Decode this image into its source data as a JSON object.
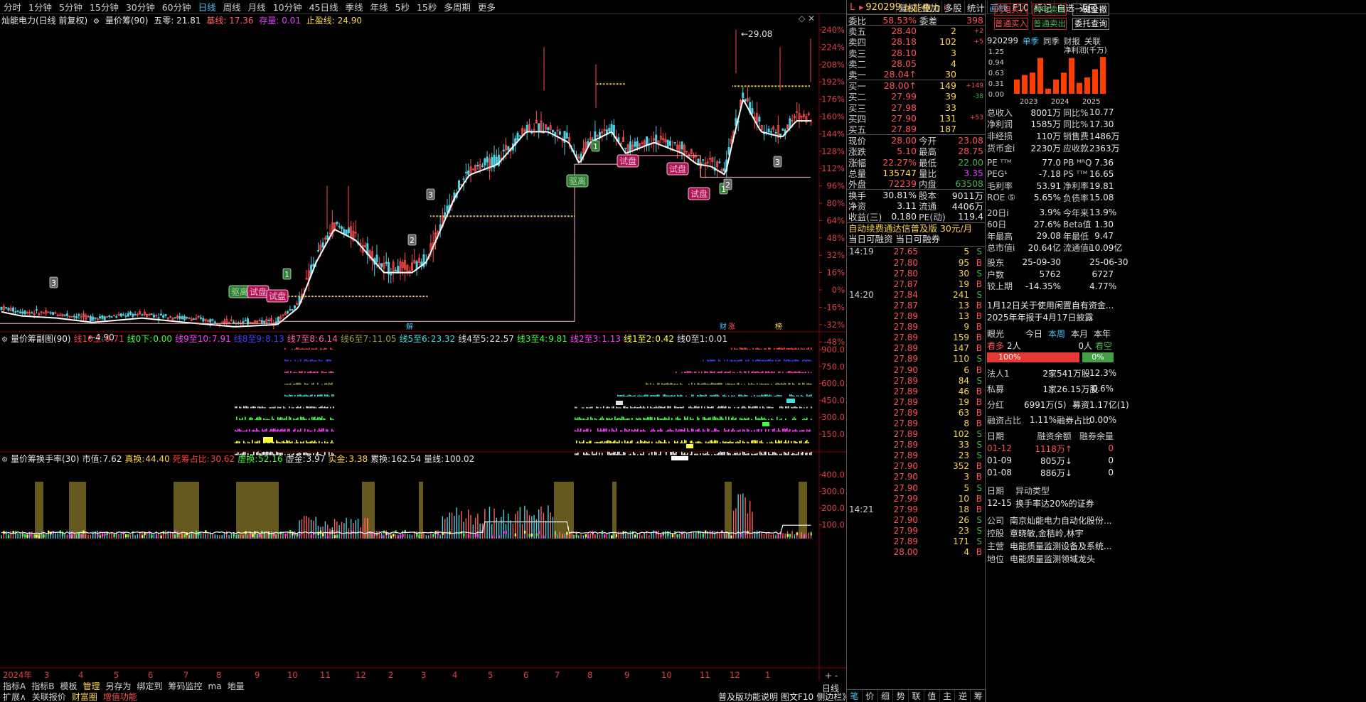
{
  "periods": [
    "分时",
    "1分钟",
    "5分钟",
    "15分钟",
    "30分钟",
    "60分钟",
    "日线",
    "周线",
    "月线",
    "10分钟",
    "45日线",
    "季线",
    "年线",
    "5秒",
    "15秒",
    "多周期",
    "更多"
  ],
  "active_period": "日线",
  "toolbar_right": [
    "复权",
    "叠加",
    "多股",
    "统计",
    "画线",
    "F10",
    "标记",
    "自选",
    "返回"
  ],
  "main_title": {
    "name": "灿能电力(日线 前复权)",
    "indicator": "量价筹(90)",
    "wuling": "五零: 21.81",
    "jixian": "基线: 17.36",
    "cunliang": "存量: 0.01",
    "zhiying": "止盈线: 24.90"
  },
  "main_axis": [
    "240%",
    "224%",
    "208%",
    "192%",
    "176%",
    "160%",
    "144%",
    "128%",
    "112%",
    "96%",
    "80%",
    "64%",
    "48%",
    "32%",
    "16%",
    "0%",
    "-16%",
    "-32%",
    "-48%"
  ],
  "annotations": {
    "high_label": "29.08",
    "low_label": "4.90",
    "tags": [
      "驱离",
      "试盘",
      "试盘",
      "驱离",
      "试盘",
      "试盘",
      "试盘"
    ],
    "nums": [
      "3",
      "1",
      "3",
      "2",
      "1",
      "3",
      "1",
      "2"
    ]
  },
  "event_icons": [
    "财",
    "涨",
    "榜",
    "解"
  ],
  "sub1_title": {
    "name": "量价筹副图(90)",
    "items": [
      {
        "label": "线10上:",
        "val": "9.71",
        "color": "#ff4040"
      },
      {
        "label": "线0下:",
        "val": "0.00",
        "color": "#40ff40"
      },
      {
        "label": "线9至10:",
        "val": "7.91",
        "color": "#ff40ff"
      },
      {
        "label": "线8至9:",
        "val": "8.13",
        "color": "#4040ff"
      },
      {
        "label": "线7至8:",
        "val": "6.14",
        "color": "#ff60a0"
      },
      {
        "label": "线6至7:",
        "val": "11.05",
        "color": "#a0a040"
      },
      {
        "label": "线5至6:",
        "val": "23.32",
        "color": "#40e0e0"
      },
      {
        "label": "线4至5:",
        "val": "22.57",
        "color": "#e0e0e0"
      },
      {
        "label": "线3至4:",
        "val": "9.81",
        "color": "#40ff40"
      },
      {
        "label": "线2至3:",
        "val": "1.13",
        "color": "#ff40ff"
      },
      {
        "label": "线1至2:",
        "val": "0.42",
        "color": "#ffff40"
      },
      {
        "label": "线0至1:",
        "val": "0.01",
        "color": "#e0e0e0"
      }
    ]
  },
  "sub1_axis": [
    "900.0",
    "750.0",
    "600.0",
    "450.0",
    "300.0",
    "150.0"
  ],
  "sub2_title": {
    "name": "量价筹换手率(30)",
    "items": [
      {
        "label": "市值:",
        "val": "7.62",
        "color": "#e0e0e0"
      },
      {
        "label": "真换:",
        "val": "44.40",
        "color": "#ffd54f"
      },
      {
        "label": "死筹占比:",
        "val": "30.62",
        "color": "#ff4040"
      },
      {
        "label": "虚换:",
        "val": "52.16",
        "color": "#40ff40"
      },
      {
        "label": "虚金:",
        "val": "3.97",
        "color": "#e0e0e0"
      },
      {
        "label": "实金:",
        "val": "3.38",
        "color": "#ffd54f"
      },
      {
        "label": "累换:",
        "val": "162.54",
        "color": "#e0e0e0"
      },
      {
        "label": "量线:",
        "val": "100.02",
        "color": "#e0e0e0"
      }
    ]
  },
  "sub2_axis": [
    "400.0",
    "300.0",
    "200.0",
    "100.0"
  ],
  "date_axis": [
    "2024年",
    "3",
    "4",
    "5",
    "6",
    "7",
    "8",
    "9",
    "10",
    "11",
    "12",
    "2",
    "3",
    "4",
    "5",
    "6",
    "7",
    "8",
    "9",
    "10",
    "11",
    "12",
    "1"
  ],
  "bottom_row1": [
    "指标A",
    "指标B",
    "模板",
    "管理",
    "另存为",
    "绑定到",
    "筹码监控",
    "ma",
    "地量"
  ],
  "bottom_row2": [
    "扩展∧",
    "关联报价",
    "财富圈",
    "增值功能"
  ],
  "period_btn": "日线",
  "quote": {
    "code": "920299",
    "name": "灿能电力",
    "weibi_label": "委比",
    "weibi": "58.53%",
    "weicha_label": "委差",
    "weicha": "398",
    "asks": [
      {
        "l": "卖五",
        "p": "28.40",
        "n": "2",
        "d": "+2"
      },
      {
        "l": "卖四",
        "p": "28.18",
        "n": "102",
        "d": "+5"
      },
      {
        "l": "卖三",
        "p": "28.10",
        "n": "3",
        "d": ""
      },
      {
        "l": "卖二",
        "p": "28.05",
        "n": "4",
        "d": ""
      },
      {
        "l": "卖一",
        "p": "28.04↑",
        "n": "30",
        "d": ""
      }
    ],
    "bids": [
      {
        "l": "买一",
        "p": "28.00↑",
        "n": "149",
        "d": "+149"
      },
      {
        "l": "买二",
        "p": "27.99",
        "n": "39",
        "d": "-38"
      },
      {
        "l": "买三",
        "p": "27.98",
        "n": "33",
        "d": ""
      },
      {
        "l": "买四",
        "p": "27.90",
        "n": "131",
        "d": "+53"
      },
      {
        "l": "买五",
        "p": "27.89",
        "n": "187",
        "d": ""
      }
    ],
    "stats": [
      {
        "l1": "现价",
        "v1": "28.00",
        "c1": "red",
        "l2": "今开",
        "v2": "23.08",
        "c2": "red"
      },
      {
        "l1": "涨跌",
        "v1": "5.10",
        "c1": "red",
        "l2": "最高",
        "v2": "28.75",
        "c2": "red"
      },
      {
        "l1": "涨幅",
        "v1": "22.27%",
        "c1": "red",
        "l2": "最低",
        "v2": "22.00",
        "c2": "green"
      },
      {
        "l1": "总量",
        "v1": "135747",
        "c1": "yellow",
        "l2": "量比",
        "v2": "3.35",
        "c2": "magenta"
      },
      {
        "l1": "外盘",
        "v1": "72239",
        "c1": "red",
        "l2": "内盘",
        "v2": "63508",
        "c2": "green"
      }
    ],
    "stats2": [
      {
        "l1": "换手",
        "v1": "30.81%",
        "l2": "股本",
        "v2": "9011万"
      },
      {
        "l1": "净资",
        "v1": "3.11",
        "l2": "流通",
        "v2": "4406万"
      },
      {
        "l1": "收益(三)",
        "v1": "0.180",
        "l2": "PE(动)",
        "v2": "119.4"
      }
    ],
    "promo": "自动续费通达信普及版 30元/月",
    "margin": "当日可融资 当日可融券",
    "ticks": [
      {
        "t": "14:19",
        "p": "27.65",
        "v": "5",
        "bs": "S"
      },
      {
        "t": "",
        "p": "27.80",
        "v": "95",
        "bs": "B"
      },
      {
        "t": "",
        "p": "27.80",
        "v": "30",
        "bs": "S"
      },
      {
        "t": "",
        "p": "27.87",
        "v": "19",
        "bs": "B"
      },
      {
        "t": "14:20",
        "p": "27.84",
        "v": "241",
        "bs": "S"
      },
      {
        "t": "",
        "p": "27.87",
        "v": "13",
        "bs": "B"
      },
      {
        "t": "",
        "p": "27.89",
        "v": "13",
        "bs": "B"
      },
      {
        "t": "",
        "p": "27.89",
        "v": "9",
        "bs": "B"
      },
      {
        "t": "",
        "p": "27.89",
        "v": "159",
        "bs": "B"
      },
      {
        "t": "",
        "p": "27.89",
        "v": "147",
        "bs": "B"
      },
      {
        "t": "",
        "p": "27.89",
        "v": "110",
        "bs": "S"
      },
      {
        "t": "",
        "p": "27.90",
        "v": "6",
        "bs": "B"
      },
      {
        "t": "",
        "p": "27.89",
        "v": "84",
        "bs": "S"
      },
      {
        "t": "",
        "p": "27.89",
        "v": "46",
        "bs": "B"
      },
      {
        "t": "",
        "p": "27.89",
        "v": "19",
        "bs": "B"
      },
      {
        "t": "",
        "p": "27.89",
        "v": "63",
        "bs": "B"
      },
      {
        "t": "",
        "p": "27.89",
        "v": "8",
        "bs": "B"
      },
      {
        "t": "",
        "p": "27.89",
        "v": "102",
        "bs": "S"
      },
      {
        "t": "",
        "p": "27.89",
        "v": "33",
        "bs": "S"
      },
      {
        "t": "",
        "p": "27.89",
        "v": "23",
        "bs": "S"
      },
      {
        "t": "",
        "p": "27.90",
        "v": "352",
        "bs": "B"
      },
      {
        "t": "",
        "p": "27.90",
        "v": "3",
        "bs": "B"
      },
      {
        "t": "",
        "p": "27.90",
        "v": "5",
        "bs": "S"
      },
      {
        "t": "",
        "p": "27.99",
        "v": "10",
        "bs": "B"
      },
      {
        "t": "14:21",
        "p": "27.99",
        "v": "18",
        "bs": "B"
      },
      {
        "t": "",
        "p": "27.90",
        "v": "26",
        "bs": "S"
      },
      {
        "t": "",
        "p": "27.99",
        "v": "23",
        "bs": "S"
      },
      {
        "t": "",
        "p": "27.89",
        "v": "171",
        "bs": "S"
      },
      {
        "t": "",
        "p": "28.00",
        "v": "4",
        "bs": "B"
      }
    ],
    "bottom_tabs": [
      "笔",
      "价",
      "细",
      "势",
      "联",
      "值",
      "主",
      "逆",
      "筹"
    ],
    "bottom_left": "普及版功能说明",
    "bottom_mid": "图文F10",
    "bottom_side": "侧边栏》"
  },
  "f10": {
    "buttons": [
      "闪电买入",
      "闪电卖出",
      "一键全撤",
      "普通买入",
      "普通卖出",
      "委托查询"
    ],
    "code": "920299",
    "tabs": [
      "单季",
      "同季",
      "财报",
      "关联"
    ],
    "profit_label": "净利润(千万)",
    "profit_axis": [
      "1.25",
      "0.94",
      "0.63",
      "0.31",
      "0.00"
    ],
    "years": [
      "2023",
      "2024",
      "2025"
    ],
    "bars": [
      0.42,
      0.55,
      0.62,
      1.05,
      0.15,
      0.42,
      0.62,
      1.05,
      0.32,
      0.48,
      0.72,
      1.08
    ],
    "fin": [
      {
        "k": "总收入",
        "v": "8001万",
        "k2": "同比%",
        "v2": "10.77"
      },
      {
        "k": "净利润",
        "v": "1585万",
        "k2": "同比%",
        "v2": "17.30"
      },
      {
        "k": "非经损",
        "v": "110万",
        "k2": "销售费",
        "v2": "1486万"
      },
      {
        "k": "货币金i",
        "v": "2230万",
        "k2": "应收款",
        "v2": "2363万"
      },
      {
        "k": "PE ᵀᵀᴹ",
        "v": "77.0",
        "k2": "PB ᴹᴿQ",
        "v2": "7.36"
      },
      {
        "k": "PEG¹",
        "v": "-7.18",
        "k2": "PS ᵀᵀᴹ",
        "v2": "16.65"
      },
      {
        "k": "毛利率",
        "v": "53.91",
        "k2": "净利率",
        "v2": "19.81"
      },
      {
        "k": "ROE ⑤",
        "v": "5.65%",
        "k2": "负债率",
        "v2": "15.08"
      },
      {
        "k": "20日i",
        "v": "3.9%",
        "k2": "今年来",
        "v2": "13.9%"
      },
      {
        "k": "60日",
        "v": "27.6%",
        "k2": "Beta值",
        "v2": "1.30"
      },
      {
        "k": "年最高",
        "v": "29.08",
        "k2": "年最低",
        "v2": "9.47"
      },
      {
        "k": "总市值i",
        "v": "20.64亿",
        "k2": "流通值i",
        "v2": "10.09亿"
      },
      {
        "k": "股东",
        "v": "25-09-30",
        "k2": "",
        "v2": "25-06-30"
      },
      {
        "k": "户数",
        "v": "5762",
        "k2": "",
        "v2": "6727"
      },
      {
        "k": "较上期",
        "v": "-14.35%",
        "k2": "",
        "v2": "4.77%"
      }
    ],
    "news": [
      "1月12日关于使用闲置自有资金...",
      "2025年年报于4月17日披露"
    ],
    "eye": {
      "label": "眼光",
      "tabs": [
        "今日",
        "本周",
        "本月",
        "本年"
      ],
      "kan_duo": "看多",
      "kan_duo_n": "2人",
      "kan_kong_n": "0人",
      "kan_kong": "看空",
      "pct_up": "100%",
      "pct_dn": "0%"
    },
    "holders": [
      {
        "k": "法人1",
        "v": "2家",
        "v2": "541万股",
        "v3": "12.3%"
      },
      {
        "k": "私募",
        "v": "1家",
        "v2": "26.15万股",
        "v3": "0.6%"
      },
      {
        "k": "分红",
        "v": "6991万(5)",
        "v2": "募资",
        "v3": "1.17亿(1)"
      },
      {
        "k": "融资占比",
        "v": "1.11%",
        "v2": "融券占比",
        "v3": "0.00%"
      }
    ],
    "margin_head": [
      "日期",
      "融资余额",
      "融券余量"
    ],
    "margin_rows": [
      {
        "d": "01-12",
        "v": "1118万↑",
        "q": "0"
      },
      {
        "d": "01-09",
        "v": "805万↓",
        "q": "0"
      },
      {
        "d": "01-08",
        "v": "886万↓",
        "q": "0"
      }
    ],
    "event_head": [
      "日期",
      "异动类型"
    ],
    "event_row": {
      "d": "12-15",
      "t": "换手率达20%的证券"
    },
    "company": [
      {
        "k": "公司",
        "v": "南京灿能电力自动化股份..."
      },
      {
        "k": "控股",
        "v": "章晓敏,金秸岭,林宇"
      },
      {
        "k": "主营",
        "v": "电能质量监测设备及系统..."
      },
      {
        "k": "地位",
        "v": "电能质量监测领域龙头"
      }
    ]
  }
}
